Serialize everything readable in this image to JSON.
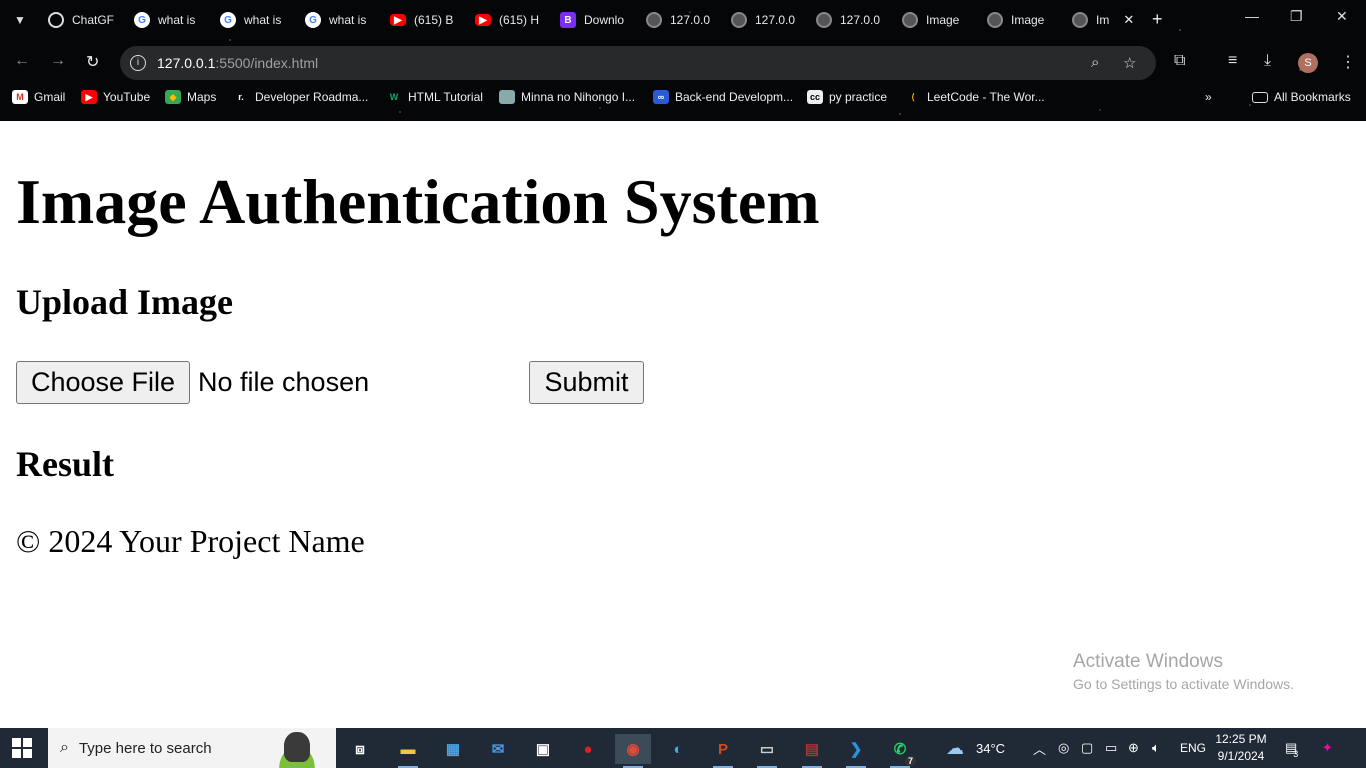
{
  "browser": {
    "tabs": [
      {
        "label": "ChatGF",
        "favicon": "chatgpt-icon"
      },
      {
        "label": "what is",
        "favicon": "google-icon"
      },
      {
        "label": "what is",
        "favicon": "google-icon"
      },
      {
        "label": "what is",
        "favicon": "google-icon"
      },
      {
        "label": "(615) B",
        "favicon": "youtube-icon"
      },
      {
        "label": "(615) H",
        "favicon": "youtube-icon"
      },
      {
        "label": "Downlo",
        "favicon": "bootstrap-icon"
      },
      {
        "label": "127.0.0",
        "favicon": "globe-icon"
      },
      {
        "label": "127.0.0",
        "favicon": "globe-icon"
      },
      {
        "label": "127.0.0",
        "favicon": "globe-icon"
      },
      {
        "label": "Image",
        "favicon": "globe-icon"
      },
      {
        "label": "Image",
        "favicon": "globe-icon"
      },
      {
        "label": "Im",
        "favicon": "globe-icon",
        "active": true
      }
    ],
    "url_host": "127.0.0.1",
    "url_rest": ":5500/index.html",
    "avatar_letter": "S",
    "bookmarks": [
      {
        "label": "Gmail",
        "icon": "gmail-icon"
      },
      {
        "label": "YouTube",
        "icon": "youtube-icon"
      },
      {
        "label": "Maps",
        "icon": "maps-icon"
      },
      {
        "label": "Developer Roadma...",
        "icon": "roadmap-icon"
      },
      {
        "label": "HTML Tutorial",
        "icon": "w3schools-icon"
      },
      {
        "label": "Minna no Nihongo I...",
        "icon": "bookmark-image-icon"
      },
      {
        "label": "Back-end Developm...",
        "icon": "coursera-icon"
      },
      {
        "label": "py practice",
        "icon": "cc-icon"
      },
      {
        "label": "LeetCode - The Wor...",
        "icon": "leetcode-icon"
      }
    ],
    "all_bookmarks_label": "All Bookmarks"
  },
  "page": {
    "title": "Image Authentication System",
    "upload_heading": "Upload Image",
    "choose_file_label": "Choose File",
    "file_status": "No file chosen",
    "submit_label": "Submit",
    "result_heading": "Result",
    "footer": "© 2024 Your Project Name"
  },
  "watermark": {
    "line1": "Activate Windows",
    "line2": "Go to Settings to activate Windows."
  },
  "taskbar": {
    "search_placeholder": "Type here to search",
    "weather": "34°C",
    "language": "ENG",
    "time": "12:25 PM",
    "date": "9/1/2024",
    "whatsapp_badge": "7",
    "notification_badge": "3"
  }
}
